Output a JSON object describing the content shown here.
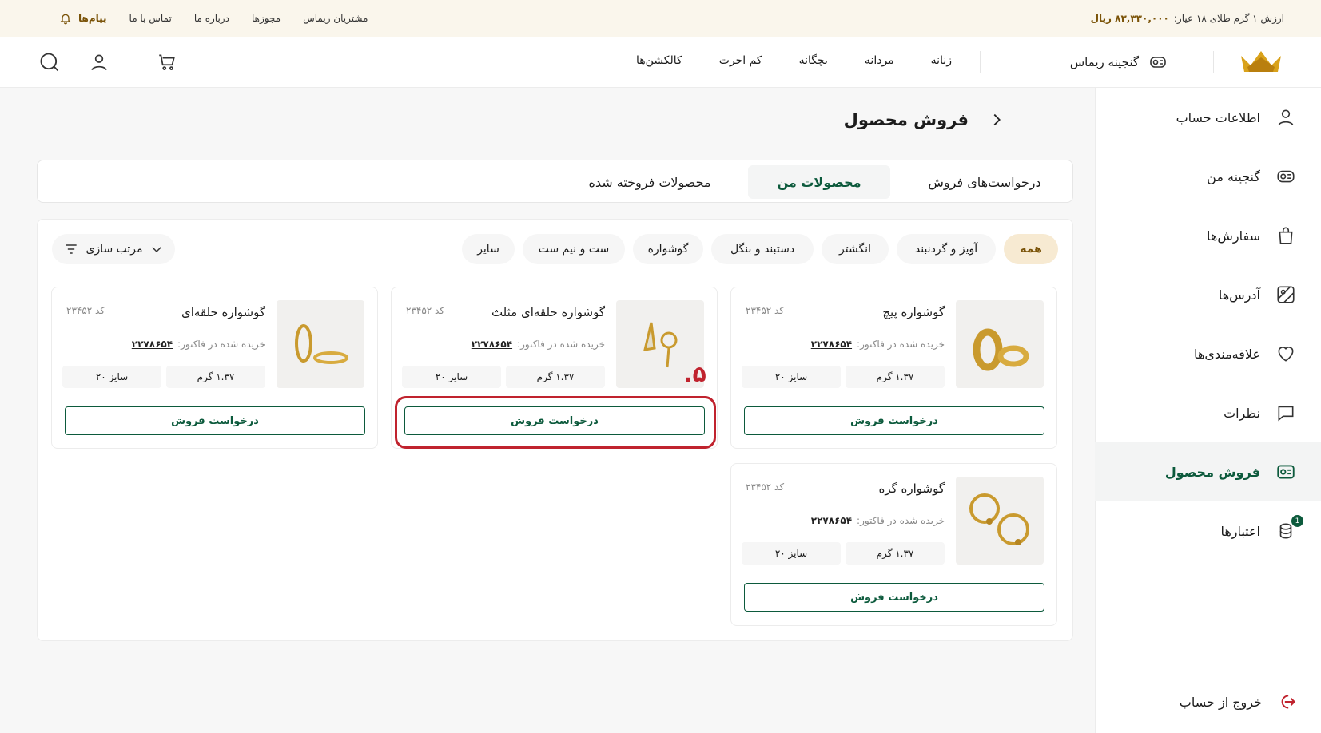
{
  "topbar": {
    "gold_label": "ارزش ۱ گرم طلای ۱۸ عیار:",
    "gold_value": "۸۳,۳۳۰,۰۰۰ ریال",
    "links": [
      "مشتریان ریماس",
      "مجوزها",
      "درباره ما",
      "تماس با ما"
    ],
    "messages": "پیام‌ها"
  },
  "header": {
    "treasure": "گنجینه ریماس",
    "nav": [
      "زنانه",
      "مردانه",
      "بچگانه",
      "کم اجرت",
      "کالکشن‌ها"
    ]
  },
  "sidebar": {
    "items": [
      {
        "label": "اطلاعات حساب",
        "icon": "user-icon"
      },
      {
        "label": "گنجینه من",
        "icon": "treasure-icon"
      },
      {
        "label": "سفارش‌ها",
        "icon": "bag-icon"
      },
      {
        "label": "آدرس‌ها",
        "icon": "map-icon"
      },
      {
        "label": "علاقه‌مندی‌ها",
        "icon": "heart-icon"
      },
      {
        "label": "نظرات",
        "icon": "comment-icon"
      },
      {
        "label": "فروش محصول",
        "icon": "sell-icon"
      },
      {
        "label": "اعتبارها",
        "icon": "coins-icon",
        "badge": "1"
      }
    ],
    "logout": "خروج از حساب",
    "accent": "#0c5a3c"
  },
  "page": {
    "title": "فروش محصول",
    "tabs": [
      "درخواست‌های فروش",
      "محصولات من",
      "محصولات فروخته شده"
    ]
  },
  "filters": {
    "chips": [
      "همه",
      "آویز و گردنبند",
      "انگشتر",
      "دستبند و بنگل",
      "گوشواره",
      "ست و نیم ست",
      "سایر"
    ],
    "sort": "مرتب سازی"
  },
  "products": [
    {
      "name": "گوشواره پیچ",
      "code": "کد ۲۳۴۵۲",
      "invoice_label": "خریده شده در فاکتور:",
      "invoice": "۲۲۷۸۶۵۴",
      "weight": "۱.۳۷ گرم",
      "size": "سایز ۲۰",
      "button": "درخواست فروش"
    },
    {
      "name": "گوشواره حلقه‌ای مثلث",
      "code": "کد ۲۳۴۵۲",
      "invoice_label": "خریده شده در فاکتور:",
      "invoice": "۲۲۷۸۶۵۴",
      "weight": "۱.۳۷ گرم",
      "size": "سایز ۲۰",
      "button": "درخواست فروش"
    },
    {
      "name": "گوشواره حلقه‌ای",
      "code": "کد ۲۳۴۵۲",
      "invoice_label": "خریده شده در فاکتور:",
      "invoice": "۲۲۷۸۶۵۴",
      "weight": "۱.۳۷ گرم",
      "size": "سایز ۲۰",
      "button": "درخواست فروش"
    },
    {
      "name": "گوشواره گره",
      "code": "کد ۲۳۴۵۲",
      "invoice_label": "خریده شده در فاکتور:",
      "invoice": "۲۲۷۸۶۵۴",
      "weight": "۱.۳۷ گرم",
      "size": "سایز ۲۰",
      "button": "درخواست فروش"
    }
  ],
  "annotation": {
    "step": "۵.",
    "color": "#c0232e"
  }
}
